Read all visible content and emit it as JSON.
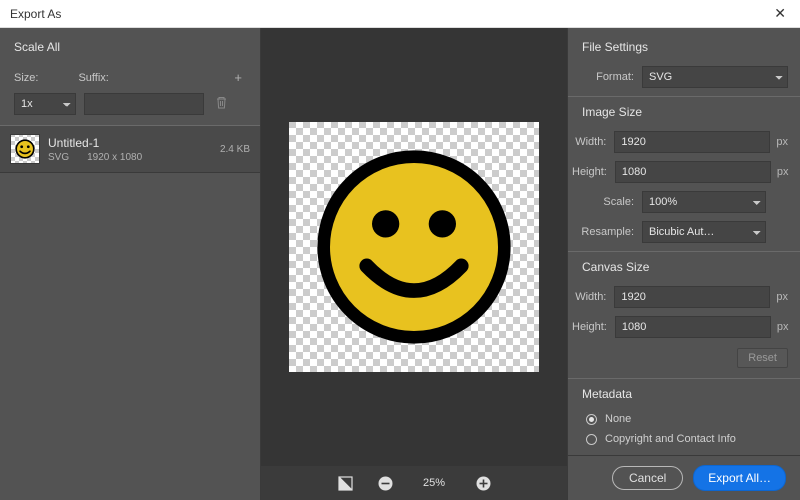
{
  "titlebar": {
    "title": "Export As"
  },
  "left": {
    "scale_all_head": "Scale All",
    "size_label": "Size:",
    "suffix_label": "Suffix:",
    "size_value": "1x",
    "suffix_value": "",
    "item": {
      "name": "Untitled-1",
      "format": "SVG",
      "dimensions": "1920 x 1080",
      "filesize": "2.4 KB"
    }
  },
  "preview": {
    "zoom_label": "25%"
  },
  "right": {
    "file_settings_head": "File Settings",
    "format_label": "Format:",
    "format_value": "SVG",
    "image_size_head": "Image Size",
    "width_label": "Width:",
    "height_label": "Height:",
    "scale_label": "Scale:",
    "resample_label": "Resample:",
    "width_value": "1920",
    "height_value": "1080",
    "scale_value": "100%",
    "resample_value": "Bicubic Aut…",
    "px_unit": "px",
    "canvas_size_head": "Canvas Size",
    "canvas_width_value": "1920",
    "canvas_height_value": "1080",
    "reset_label": "Reset",
    "metadata_head": "Metadata",
    "radio_none": "None",
    "radio_copyright": "Copyright and Contact Info"
  },
  "footer": {
    "cancel": "Cancel",
    "export": "Export All…"
  }
}
